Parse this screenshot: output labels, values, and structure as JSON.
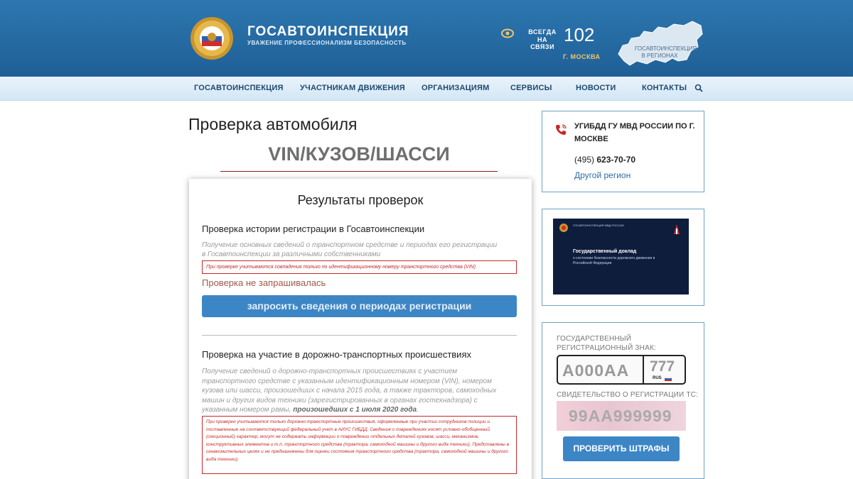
{
  "header": {
    "brand_title": "ГОСАВТОИНСПЕКЦИЯ",
    "brand_subtitle": "УВАЖЕНИЕ ПРОФЕССИОНАЛИЗМ БЕЗОПАСНОСТЬ",
    "always_line1": "ВСЕГДА",
    "always_line2": "НА СВЯЗИ",
    "emergency_number": "102",
    "city": "Г. МОСКВА",
    "regions_label": "ГОСАВТОИНСПЕКЦИЯ В РЕГИОНАХ"
  },
  "nav": {
    "items": [
      "ГОСАВТОИНСПЕКЦИЯ",
      "УЧАСТНИКАМ ДВИЖЕНИЯ",
      "ОРГАНИЗАЦИЯМ",
      "СЕРВИСЫ",
      "НОВОСТИ",
      "КОНТАКТЫ"
    ]
  },
  "main": {
    "page_title": "Проверка автомобиля",
    "vin_title": "VIN/КУЗОВ/ШАССИ",
    "card_title": "Результаты проверок",
    "section1": {
      "title": "Проверка истории регистрации в Госавтоинспекции",
      "description": "Получение основных сведений о транспортном средстве и периодах его регистрации в Госавтоинспекции за различными собственниками",
      "notice": "При проверке учитываются совпадения только по идентификационному номеру транспортного средства (VIN)",
      "status": "Проверка не запрашивалась",
      "button": "запросить сведения о периодах регистрации"
    },
    "section2": {
      "title": "Проверка на участие в дорожно-транспортных происшествиях",
      "description": "Получение сведений о дорожно-транспортных происшествиях с участием транспортного средстве с указанным идентификационным номером (VIN), номером кузова или шасси, произошедших с начала 2015 года, а также тракторов, самоходных машин и других видов техники (зарегистрированных в органах гостехнадзора) с указанным номером рамы,",
      "description_bold": "произошедших с 1 июля 2020 года",
      "notice": "При проверке учитываются только дорожно-транспортные происшествия, оформленные при участии сотрудников полиции и поставленные на соответствующий федеральный учет в АИУС ГИБДД. Сведения о повреждениях носят условно-обобщенный (секционный) характер, могут не содержать информации о повреждении отдельных деталей кузовов, шасси, механизмов, конструктивных элементов и т.п. транспортного средства (трактора, самоходной машины и другого вида техники). Представлены в ознакомительных целях и не предназначены для оценки состояния транспортного средства (трактора, самоходной машины и другого вида техники)."
    }
  },
  "sidebar": {
    "contact": {
      "unit_name": "УГИБДД ГУ МВД РОССИИ ПО Г. МОСКВЕ",
      "phone_code": "(495)",
      "phone_number": "623-70-70",
      "other_region": "Другой регион"
    },
    "report": {
      "org": "ГОСАВТОИНСПЕКЦИЯ МВД РОССИИ",
      "title": "Государственный доклад",
      "subtitle": "о состоянии безопасности дорожного движения в Российской Федерации"
    },
    "fines": {
      "plate_label_line1": "ГОСУДАРСТВЕННЫЙ",
      "plate_label_line2": "РЕГИСТРАЦИОННЫЙ ЗНАК:",
      "plate_number": "А000АА",
      "plate_region": "777",
      "plate_country": "RUS",
      "cert_label": "СВИДЕТЕЛЬСТВО О РЕГИСТРАЦИИ ТС:",
      "cert_number": "99АА999999",
      "button": "ПРОВЕРИТЬ ШТРАФЫ"
    }
  },
  "colors": {
    "header_blue": "#1f5f96",
    "button_blue": "#3d86c6",
    "notice_red": "#c62828",
    "status_brown": "#a0594a",
    "link_blue": "#2e6da4"
  }
}
